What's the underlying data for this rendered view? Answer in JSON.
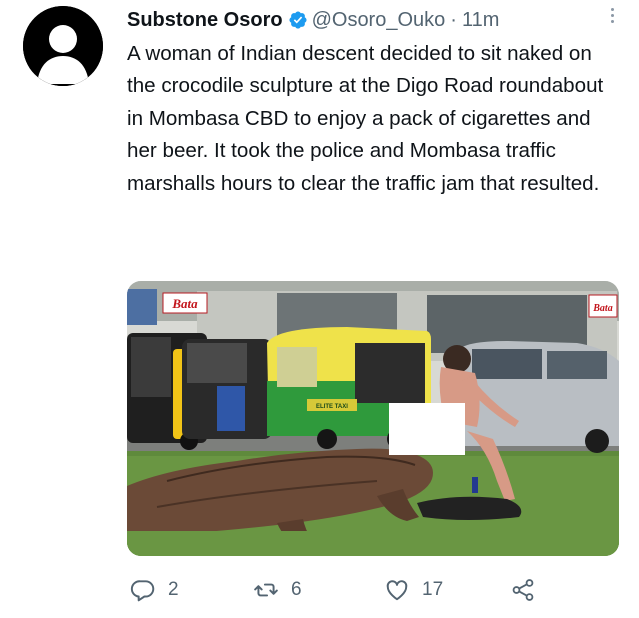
{
  "tweet": {
    "author": {
      "name": "Substone Osoro",
      "handle": "@Osoro_Ouko",
      "verified": true
    },
    "separator": "·",
    "time": "11m",
    "text": "A woman of Indian descent decided to sit naked on the crocodile sculpture at the Digo Road roundabout in Mombasa CBD to enjoy a pack of cigarettes and her beer. It took the police and Mombasa traffic marshalls hours to clear the traffic jam that resulted.",
    "media": {
      "signs": [
        "Bata",
        "Bata"
      ],
      "tuktuk_plate": "ELITE TAXI"
    },
    "actions": {
      "reply_count": "2",
      "retweet_count": "6",
      "like_count": "17"
    }
  },
  "icons": {
    "avatar": "default-avatar-icon",
    "verified": "verified-badge-icon",
    "more": "more-options-icon",
    "reply": "reply-icon",
    "retweet": "retweet-icon",
    "like": "heart-icon",
    "share": "share-icon"
  },
  "colors": {
    "verified": "#1d9bf0",
    "text": "#0f1419",
    "muted": "#536471"
  }
}
